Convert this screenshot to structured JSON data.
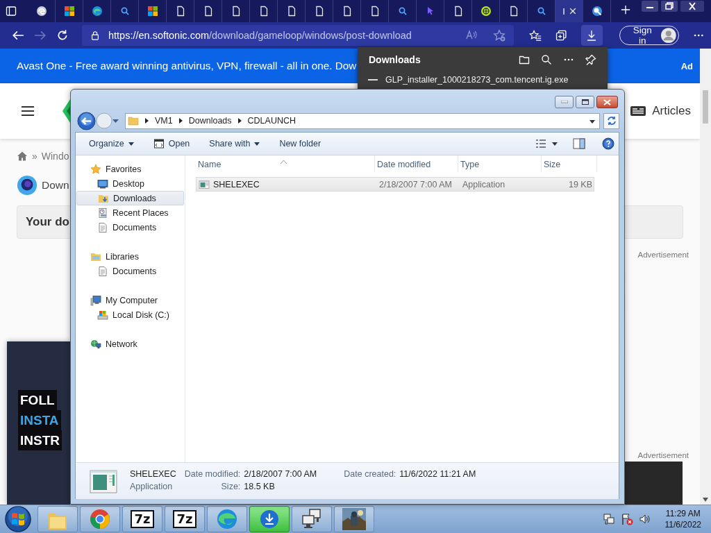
{
  "browser": {
    "tabs": [
      {
        "kind": "circle-logo",
        "selected": false
      },
      {
        "kind": "four-squares",
        "selected": false
      },
      {
        "kind": "swirl",
        "selected": false
      },
      {
        "kind": "search",
        "selected": false
      },
      {
        "kind": "four-squares",
        "selected": false
      },
      {
        "kind": "page",
        "selected": false
      },
      {
        "kind": "page",
        "selected": false
      },
      {
        "kind": "page",
        "selected": false
      },
      {
        "kind": "page",
        "selected": false
      },
      {
        "kind": "page",
        "selected": false
      },
      {
        "kind": "page",
        "selected": false
      },
      {
        "kind": "page",
        "selected": false
      },
      {
        "kind": "page",
        "selected": false
      },
      {
        "kind": "search",
        "selected": false
      },
      {
        "kind": "pointer",
        "selected": false
      },
      {
        "kind": "page",
        "selected": false
      },
      {
        "kind": "round-logo",
        "selected": false
      },
      {
        "kind": "page",
        "selected": false
      },
      {
        "kind": "search",
        "selected": false
      },
      {
        "kind": "none",
        "title": "I",
        "selected": true
      },
      {
        "kind": "globe",
        "selected": false
      }
    ],
    "address": {
      "host": "https://en.softonic.com",
      "path": "/download/gameloop/windows/post-download"
    },
    "downloads_button": {
      "active": true
    },
    "sign_in": "Sign in"
  },
  "page": {
    "banner": {
      "text": "Avast One - Free award winning antivirus, VPN, firewall - all in one. Dow",
      "badge": "Ad"
    },
    "header": {
      "link": "Articles"
    },
    "breadcrumb": {
      "separator": "»",
      "item": "Windo"
    },
    "title": "Down",
    "notice": "Your do",
    "promo_lines": [
      {
        "text": "FOLL",
        "highlighted": false
      },
      {
        "text": "INSTA",
        "highlighted": true
      },
      {
        "text": "INSTR",
        "highlighted": false
      }
    ],
    "ad_labels": [
      "Advertisement",
      "Advertisement"
    ]
  },
  "downloads_panel": {
    "title": "Downloads",
    "items": [
      "GLP_installer_1000218273_com.tencent.ig.exe"
    ]
  },
  "explorer": {
    "path": [
      "VM1",
      "Downloads",
      "CDLAUNCH"
    ],
    "toolbar": [
      {
        "label": "Organize",
        "kind": "menu"
      },
      {
        "label": "Open",
        "kind": "icon"
      },
      {
        "label": "Share with",
        "kind": "menu"
      },
      {
        "label": "New folder",
        "kind": "plain"
      }
    ],
    "nav": [
      {
        "label": "Favorites",
        "kind": "star",
        "selected": false,
        "children": [
          {
            "label": "Desktop",
            "kind": "desktop",
            "selected": false
          },
          {
            "label": "Downloads",
            "kind": "downloads",
            "selected": true
          },
          {
            "label": "Recent Places",
            "kind": "recent",
            "selected": false
          },
          {
            "label": "Documents",
            "kind": "document",
            "selected": false
          }
        ]
      },
      {
        "label": "Libraries",
        "kind": "library",
        "selected": false,
        "children": [
          {
            "label": "Documents",
            "kind": "document",
            "selected": false
          }
        ]
      },
      {
        "label": "My Computer",
        "kind": "computer",
        "selected": false,
        "children": [
          {
            "label": "Local Disk (C:)",
            "kind": "disk",
            "selected": false
          }
        ]
      },
      {
        "label": "Network",
        "kind": "network",
        "selected": false
      }
    ],
    "columns": [
      "Name",
      "Date modified",
      "Type",
      "Size"
    ],
    "files": [
      {
        "name": "SHELEXEC",
        "date_modified": "2/18/2007 7:00 AM",
        "type": "Application",
        "size": "19 KB",
        "selected": true
      }
    ],
    "details": {
      "name": "SHELEXEC",
      "type": "Application",
      "fields": [
        {
          "label": "Date modified:",
          "value": "2/18/2007 7:00 AM"
        },
        {
          "label": "Date created:",
          "value": "11/6/2022 11:21 AM"
        },
        {
          "label": "Size:",
          "value": "18.5 KB"
        }
      ]
    }
  },
  "taskbar": {
    "apps": [
      {
        "kind": "folder",
        "active": false
      },
      {
        "kind": "chrome",
        "active": false
      },
      {
        "kind": "archive",
        "text": "7z",
        "active": false
      },
      {
        "kind": "archive",
        "text": "7z",
        "active": false
      },
      {
        "kind": "swirl",
        "active": false
      },
      {
        "kind": "download",
        "active": true
      },
      {
        "kind": "computers",
        "active": false
      },
      {
        "kind": "picture",
        "active": false
      }
    ],
    "clock": {
      "time": "11:29 AM",
      "date": "11/6/2022"
    }
  }
}
